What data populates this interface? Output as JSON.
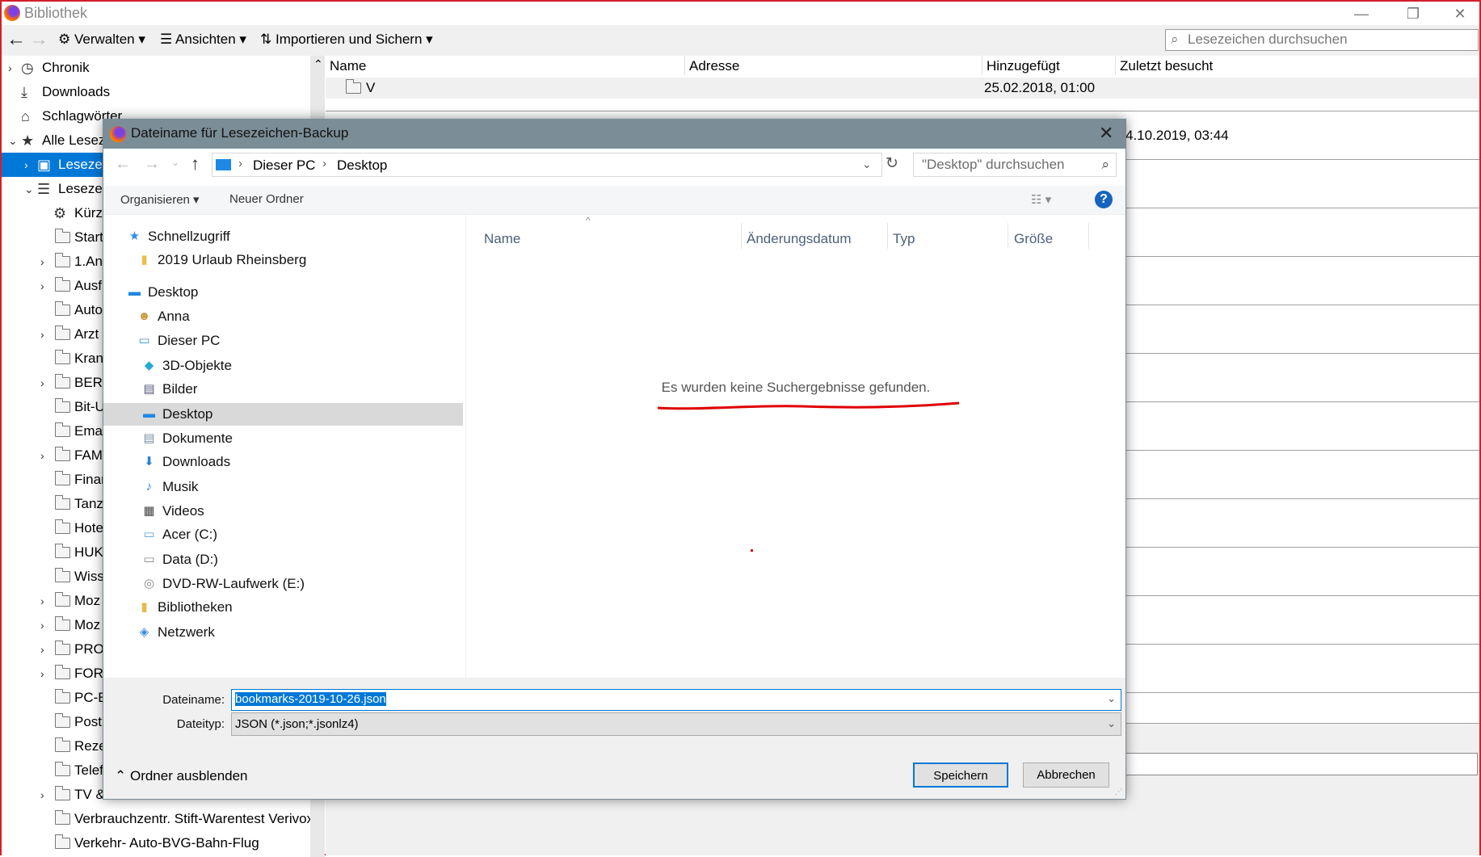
{
  "window": {
    "title": "Bibliothek",
    "minimize": "—",
    "restore": "❐",
    "close": "✕"
  },
  "toolbar": {
    "back": "←",
    "forward": "→",
    "manage": "Verwalten",
    "views": "Ansichten",
    "import": "Importieren und Sichern",
    "search_placeholder": "Lesezeichen durchsuchen"
  },
  "tree": [
    {
      "label": "Chronik",
      "icon": "clock",
      "chev": "›",
      "level": 0
    },
    {
      "label": "Downloads",
      "icon": "download",
      "level": 0
    },
    {
      "label": "Schlagwörter",
      "icon": "tag",
      "level": 0
    },
    {
      "label": "Alle Lesez",
      "icon": "star",
      "chev": "⌄",
      "level": 0
    },
    {
      "label": "Lesezei",
      "icon": "bookmark-toolbar",
      "chev": "›",
      "level": 1,
      "selected": true
    },
    {
      "label": "Lesezei",
      "icon": "bookmark-menu",
      "chev": "⌄",
      "level": 1
    },
    {
      "label": "Kürz",
      "icon": "gear",
      "level": 2
    },
    {
      "label": "Start",
      "icon": "folder",
      "level": 2
    },
    {
      "label": "1.An",
      "icon": "folder",
      "chev": "›",
      "level": 2
    },
    {
      "label": "Ausf",
      "icon": "folder",
      "chev": "›",
      "level": 2
    },
    {
      "label": "Auto",
      "icon": "folder",
      "level": 2
    },
    {
      "label": " Arzt",
      "icon": "folder",
      "chev": "›",
      "level": 2
    },
    {
      "label": "Kran",
      "icon": "folder",
      "level": 2
    },
    {
      "label": "BERL",
      "icon": "folder",
      "chev": "›",
      "level": 2
    },
    {
      "label": "Bit-U",
      "icon": "folder",
      "level": 2
    },
    {
      "label": "Emai",
      "icon": "folder",
      "level": 2
    },
    {
      "label": "FAM",
      "icon": "folder",
      "chev": "›",
      "level": 2
    },
    {
      "label": "Finar",
      "icon": "folder",
      "level": 2
    },
    {
      "label": "Tanz",
      "icon": "folder",
      "level": 2
    },
    {
      "label": "Hote",
      "icon": "folder",
      "level": 2
    },
    {
      "label": "HUK",
      "icon": "folder",
      "level": 2
    },
    {
      "label": "Wiss",
      "icon": "folder",
      "level": 2
    },
    {
      "label": "Moz",
      "icon": "folder",
      "chev": "›",
      "level": 2
    },
    {
      "label": "Moz",
      "icon": "folder",
      "chev": "›",
      "level": 2
    },
    {
      "label": "PRO",
      "icon": "folder",
      "chev": "›",
      "level": 2
    },
    {
      "label": "FORI",
      "icon": "folder",
      "chev": "›",
      "level": 2
    },
    {
      "label": "PC-E",
      "icon": "folder",
      "level": 2
    },
    {
      "label": "Post",
      "icon": "folder",
      "level": 2
    },
    {
      "label": "Reze",
      "icon": "folder",
      "level": 2
    },
    {
      "label": "Telef",
      "icon": "folder",
      "level": 2
    },
    {
      "label": "TV  &",
      "icon": "folder",
      "chev": "›",
      "level": 2
    },
    {
      "label": "Verbrauchzentr. Stift-Warentest Verivox",
      "icon": "folder",
      "level": 2
    },
    {
      "label": "Verkehr- Auto-BVG-Bahn-Flug",
      "icon": "folder",
      "level": 2
    }
  ],
  "list": {
    "columns": [
      "Name",
      "Adresse",
      "Hinzugefügt",
      "Zuletzt besucht"
    ],
    "rows": [
      {
        "name": "V",
        "added": "25.02.2018, 01:00"
      }
    ],
    "partial_date": "4.10.2019, 03:44"
  },
  "dialog": {
    "title": "Dateiname für Lesezeichen-Backup",
    "breadcrumb": [
      "Dieser PC",
      "Desktop"
    ],
    "search_placeholder": "\"Desktop\" durchsuchen",
    "organize": "Organisieren",
    "new_folder": "Neuer Ordner",
    "nav": [
      {
        "label": "Schnellzugriff",
        "icon": "★",
        "color": "#2f8fe0",
        "level": 0
      },
      {
        "label": "2019 Urlaub Rheinsberg",
        "icon": "▮",
        "color": "#e8c04a",
        "level": 1
      },
      {
        "label": "Desktop",
        "icon": "▬",
        "color": "#1e88e5",
        "level": 0,
        "gap": true
      },
      {
        "label": "Anna",
        "icon": "☻",
        "color": "#c89a3a",
        "level": 1
      },
      {
        "label": "Dieser PC",
        "icon": "▭",
        "color": "#3b8fd8",
        "level": 1
      },
      {
        "label": "3D-Objekte",
        "icon": "◆",
        "color": "#27a9d6",
        "level": 2
      },
      {
        "label": "Bilder",
        "icon": "▤",
        "color": "#557",
        "level": 2
      },
      {
        "label": "Desktop",
        "icon": "▬",
        "color": "#1e88e5",
        "level": 2,
        "selected": true
      },
      {
        "label": "Dokumente",
        "icon": "▤",
        "color": "#7a8da0",
        "level": 2
      },
      {
        "label": "Downloads",
        "icon": "⬇",
        "color": "#2f7fd8",
        "level": 2
      },
      {
        "label": "Musik",
        "icon": "♪",
        "color": "#2f7fd8",
        "level": 2
      },
      {
        "label": "Videos",
        "icon": "▦",
        "color": "#444",
        "level": 2
      },
      {
        "label": "Acer (C:)",
        "icon": "▭",
        "color": "#5aa0d8",
        "level": 2
      },
      {
        "label": "Data (D:)",
        "icon": "▭",
        "color": "#888",
        "level": 2
      },
      {
        "label": "DVD-RW-Laufwerk (E:)",
        "icon": "◎",
        "color": "#888",
        "level": 2
      },
      {
        "label": "Bibliotheken",
        "icon": "▮",
        "color": "#e8b84a",
        "level": 1
      },
      {
        "label": "Netzwerk",
        "icon": "◈",
        "color": "#3b8fd8",
        "level": 1
      }
    ],
    "columns": [
      "Name",
      "Änderungsdatum",
      "Typ",
      "Größe"
    ],
    "empty_message": "Es wurden keine Suchergebnisse gefunden.",
    "filename_label": "Dateiname:",
    "filename": "bookmarks-2019-10-26.json",
    "filetype_label": "Dateityp:",
    "filetype": "JSON (*.json;*.jsonlz4)",
    "hide_folders": "Ordner ausblenden",
    "save": "Speichern",
    "cancel": "Abbrechen",
    "help": "?"
  },
  "colors": {
    "accent": "#0078d7",
    "dialog_title": "#7b8d97",
    "annotation": "#e00000"
  }
}
